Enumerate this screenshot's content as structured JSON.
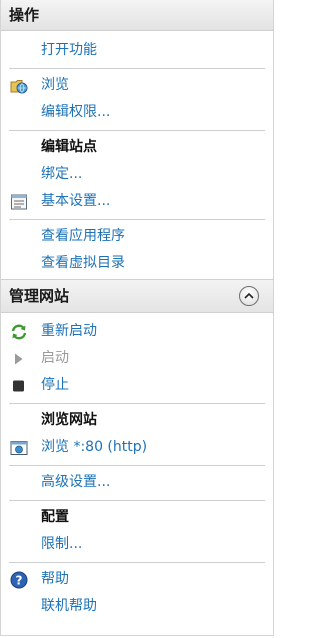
{
  "panel": {
    "title": "操作",
    "items": {
      "open_feature": "打开功能",
      "browse": "浏览",
      "edit_permissions": "编辑权限..."
    },
    "edit_site": {
      "title": "编辑站点",
      "bindings": "绑定...",
      "basic_settings": "基本设置...",
      "view_applications": "查看应用程序",
      "view_virtual_dirs": "查看虚拟目录"
    }
  },
  "manage_site": {
    "title": "管理网站",
    "restart": "重新启动",
    "start": "启动",
    "stop": "停止",
    "browse_site_title": "浏览网站",
    "browse_http": "浏览 *:80 (http)",
    "advanced_settings": "高级设置...",
    "config_title": "配置",
    "limits": "限制...",
    "help": "帮助",
    "online_help": "联机帮助"
  },
  "colors": {
    "link": "#1e73b7",
    "disabled": "#9a9a9a",
    "header_bg": "#e8e8e8"
  },
  "icons": {
    "browse": "folder-globe-icon",
    "basic_settings": "settings-window-icon",
    "collapse": "chevron-up-icon",
    "restart": "restart-arrows-icon",
    "start": "play-icon",
    "stop": "stop-icon",
    "browse_http": "browser-window-icon",
    "help": "help-icon"
  }
}
